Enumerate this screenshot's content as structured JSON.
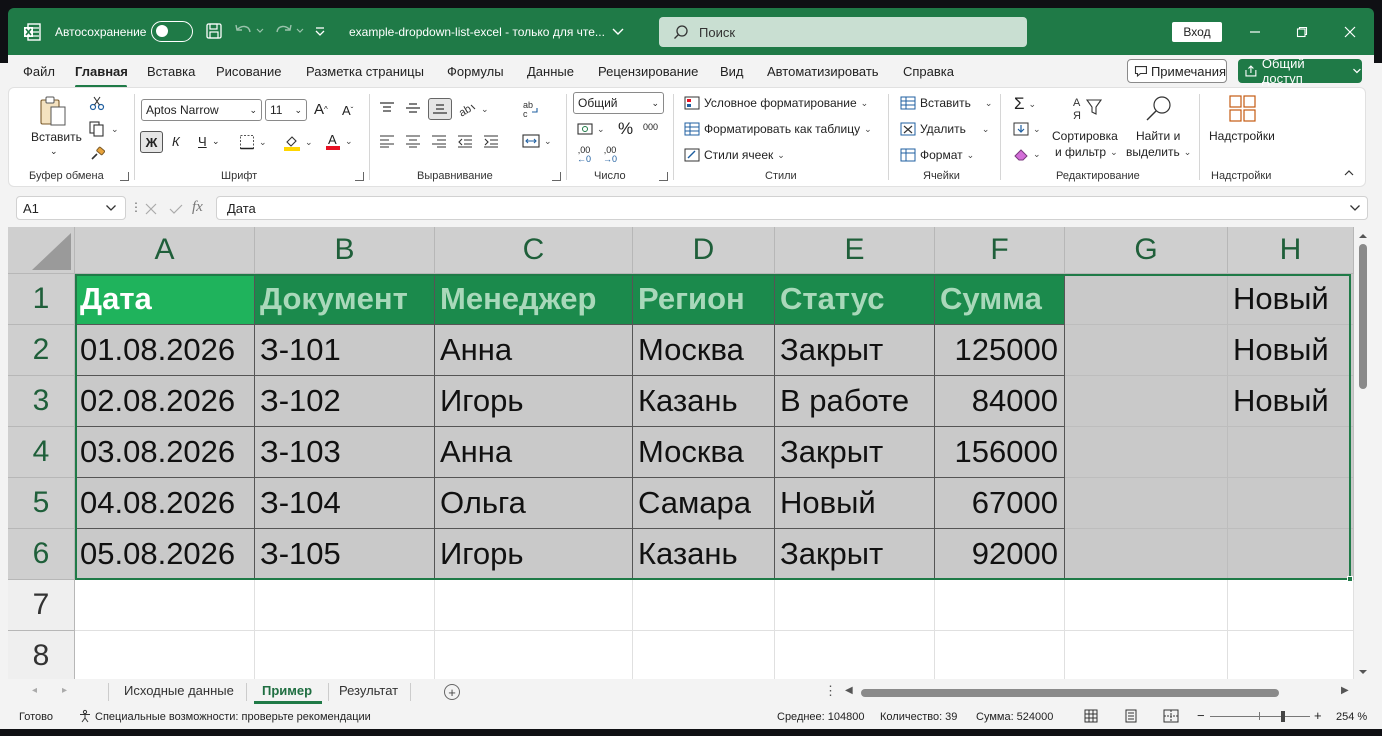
{
  "titlebar": {
    "autosave_label": "Автосохранение",
    "doc_title": "example-dropdown-list-excel  -  только для чте...",
    "search_placeholder": "Поиск",
    "signin_label": "Вход"
  },
  "menu": {
    "tabs": [
      "Файл",
      "Главная",
      "Вставка",
      "Рисование",
      "Разметка страницы",
      "Формулы",
      "Данные",
      "Рецензирование",
      "Вид",
      "Автоматизировать",
      "Справка"
    ],
    "active_tab": "Главная",
    "comments_label": "Примечания",
    "share_label": "Общий доступ"
  },
  "ribbon": {
    "clipboard": {
      "paste": "Вставить",
      "label": "Буфер обмена"
    },
    "font": {
      "name": "Aptos Narrow",
      "size": "11",
      "bold": "Ж",
      "italic": "К",
      "underline": "Ч",
      "label": "Шрифт"
    },
    "alignment": {
      "label": "Выравнивание"
    },
    "number": {
      "format": "Общий",
      "percent": "%",
      "thousands": "000",
      "inc_decimal": ",00",
      "dec_decimal": ",00",
      "label": "Число"
    },
    "styles": {
      "conditional": "Условное форматирование",
      "as_table": "Форматировать как таблицу",
      "cell_styles": "Стили ячеек",
      "label": "Стили"
    },
    "cells": {
      "insert": "Вставить",
      "delete": "Удалить",
      "format": "Формат",
      "label": "Ячейки"
    },
    "editing": {
      "sort_line1": "Сортировка",
      "sort_line2": "и фильтр",
      "find_line1": "Найти и",
      "find_line2": "выделить",
      "label": "Редактирование"
    },
    "addins": {
      "button": "Надстройки",
      "label": "Надстройки"
    }
  },
  "formula_bar": {
    "name_box": "A1",
    "fx": "fx",
    "value": "Дата"
  },
  "grid": {
    "columns": [
      "A",
      "B",
      "C",
      "D",
      "E",
      "F",
      "G",
      "H"
    ],
    "rows": [
      "1",
      "2",
      "3",
      "4",
      "5",
      "6",
      "7",
      "8"
    ],
    "header_row": [
      "Дата",
      "Документ",
      "Менеджер",
      "Регион",
      "Статус",
      "Сумма"
    ],
    "data_rows": [
      [
        "01.08.2026",
        "З-101",
        "Анна",
        "Москва",
        "Закрыт",
        "125000"
      ],
      [
        "02.08.2026",
        "З-102",
        "Игорь",
        "Казань",
        "В работе",
        "84000"
      ],
      [
        "03.08.2026",
        "З-103",
        "Анна",
        "Москва",
        "Закрыт",
        "156000"
      ],
      [
        "04.08.2026",
        "З-104",
        "Ольга",
        "Самара",
        "Новый",
        "67000"
      ],
      [
        "05.08.2026",
        "З-105",
        "Игорь",
        "Казань",
        "Закрыт",
        "92000"
      ]
    ],
    "column_h_values": [
      "Новый",
      "Новый",
      "Новый"
    ]
  },
  "sheets": {
    "tabs": [
      "Исходные данные",
      "Пример",
      "Результат"
    ],
    "active": "Пример"
  },
  "status": {
    "ready": "Готово",
    "accessibility": "Специальные возможности: проверьте рекомендации",
    "average": "Среднее: 104800",
    "count": "Количество: 39",
    "sum": "Сумма: 524000",
    "zoom": "254 %"
  },
  "colors": {
    "excel_green": "#1f7a47",
    "header_fill": "#1b8a4c",
    "header_first_fill": "#1fb35c",
    "selection_fill": "#c9c9c9"
  }
}
